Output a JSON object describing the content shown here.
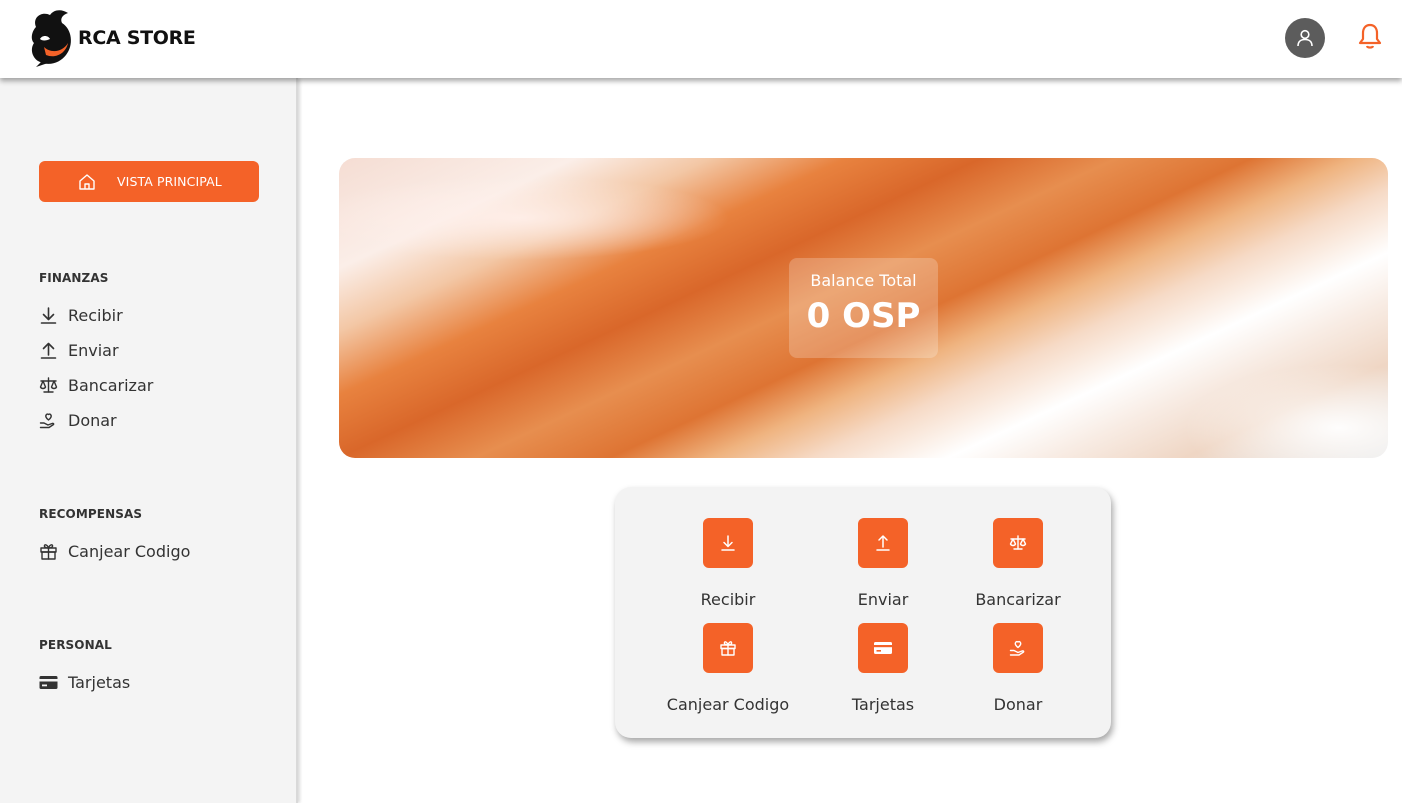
{
  "header": {
    "brand": "RCA STORE"
  },
  "sidebar": {
    "main_button": "VISTA PRINCIPAL",
    "sections": [
      {
        "title": "FINANZAS",
        "items": [
          "Recibir",
          "Enviar",
          "Bancarizar",
          "Donar"
        ]
      },
      {
        "title": "RECOMPENSAS",
        "items": [
          "Canjear Codigo"
        ]
      },
      {
        "title": "PERSONAL",
        "items": [
          "Tarjetas"
        ]
      }
    ]
  },
  "balance": {
    "label": "Balance Total",
    "value": "0 OSP"
  },
  "actions": [
    {
      "label": "Recibir",
      "icon": "download-icon"
    },
    {
      "label": "Enviar",
      "icon": "upload-icon"
    },
    {
      "label": "Bancarizar",
      "icon": "scale-icon"
    },
    {
      "label": "Canjear Codigo",
      "icon": "gift-icon"
    },
    {
      "label": "Tarjetas",
      "icon": "credit-card-icon"
    },
    {
      "label": "Donar",
      "icon": "donate-hand-icon"
    }
  ],
  "colors": {
    "accent": "#f46228",
    "sidebar_bg": "#f4f4f4",
    "avatar_bg": "#5c5c5c"
  }
}
